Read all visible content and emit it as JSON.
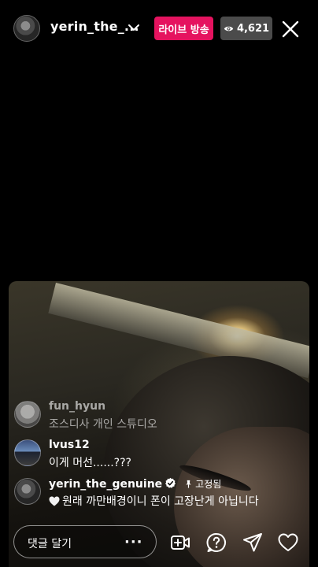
{
  "header": {
    "username": "yerin_the_...",
    "live_label": "라이브 방송",
    "viewer_count": "4,621"
  },
  "comments": [
    {
      "username": "fun_hyun",
      "text": "조스디사 개인 스튜디오"
    },
    {
      "username": "lvus12",
      "text": "이게 머선......???"
    },
    {
      "username": "yerin_the_genuine",
      "pinned_label": "고정됨",
      "text": "원래 까만배경이니 폰이 고장난게 아닙니다"
    }
  ],
  "input": {
    "placeholder": "댓글 달기",
    "more_label": "···"
  },
  "colors": {
    "live_badge": "#e5135f",
    "viewer_badge": "#4b4b4b",
    "verified": "#ffffff"
  },
  "icons": [
    "chevron-down-icon",
    "eye-icon",
    "close-icon",
    "verified-icon",
    "pin-icon",
    "heart-icon",
    "add-video-icon",
    "question-icon",
    "send-icon",
    "like-icon"
  ]
}
